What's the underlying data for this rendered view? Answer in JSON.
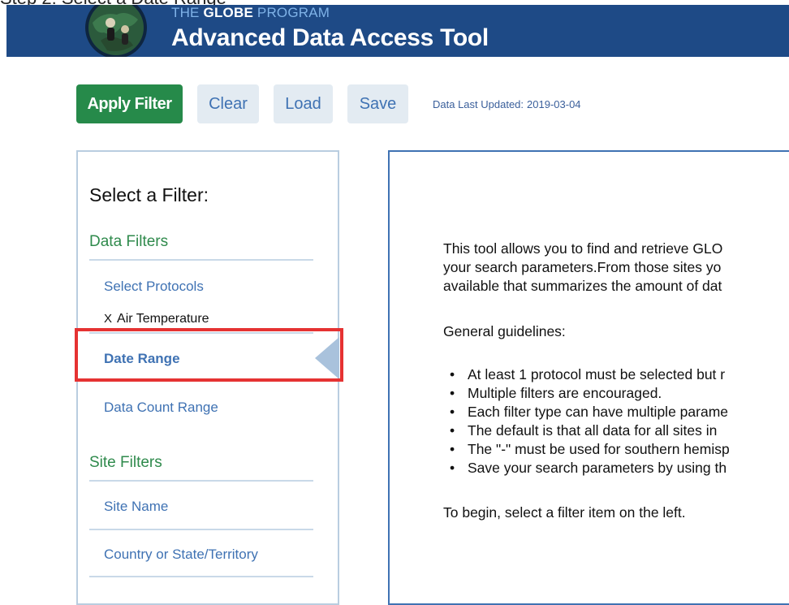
{
  "header": {
    "program_prefix": "THE ",
    "program_bold": "GLOBE",
    "program_suffix": " PROGRAM",
    "app_title": "Advanced Data Access Tool",
    "brand_color": "#1e4a86"
  },
  "toolbar": {
    "apply_label": "Apply Filter",
    "clear_label": "Clear",
    "load_label": "Load",
    "save_label": "Save",
    "updated_label": "Data Last Updated:",
    "updated_value": "2019-03-04"
  },
  "sidebar": {
    "heading": "Select a Filter:",
    "data_filters_title": "Data Filters",
    "select_protocols": "Select Protocols",
    "selected_protocol_remove": "X",
    "selected_protocol": "Air Temperature",
    "date_range": "Date Range",
    "data_count_range": "Data Count Range",
    "site_filters_title": "Site Filters",
    "site_name": "Site Name",
    "country_state": "Country or State/Territory"
  },
  "content": {
    "intro_line1": "This tool allows you to find and retrieve GLO",
    "intro_line2": "your search parameters.From those sites yo",
    "intro_line3": "available that summarizes the amount of dat",
    "guidelines_title": "General guidelines:",
    "guidelines": [
      "At least 1 protocol must be selected but r",
      "Multiple filters are encouraged.",
      "Each filter type can have multiple parame",
      "The default is that all data for all sites in",
      "The \"-\" must be used for southern hemisp",
      "Save your search parameters by using th"
    ],
    "begin_text": "To begin, select a filter item on the left."
  },
  "colors": {
    "apply_button": "#268a4a",
    "secondary_button": "#e3ebf2",
    "link_blue": "#3f72b3",
    "section_green": "#2f8a4c",
    "highlight_red": "#e53232"
  }
}
